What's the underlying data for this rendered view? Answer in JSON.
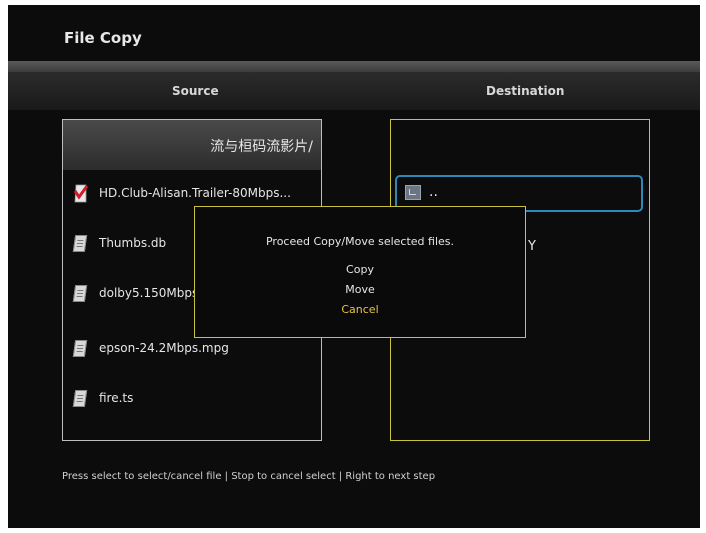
{
  "title": "File Copy",
  "columns": {
    "source": "Source",
    "destination": "Destination"
  },
  "source_panel": {
    "path": "流与桓码流影片/",
    "files": [
      {
        "name": "HD.Club-Alisan.Trailer-80Mbps...",
        "icon": "selected-check-icon",
        "selected": true
      },
      {
        "name": "Thumbs.db",
        "icon": "file-icon",
        "selected": false
      },
      {
        "name": "dolby5.150Mbps",
        "icon": "file-icon",
        "selected": false
      },
      {
        "name": "epson-24.2Mbps.mpg",
        "icon": "file-icon",
        "selected": false
      },
      {
        "name": "fire.ts",
        "icon": "file-icon",
        "selected": false
      }
    ]
  },
  "destination_panel": {
    "selected_item": "..",
    "selected_icon": "folder-up-icon",
    "partial_item": "Y"
  },
  "dialog": {
    "message": "Proceed Copy/Move selected files.",
    "options": [
      "Copy",
      "Move",
      "Cancel"
    ],
    "highlighted_option": "Cancel"
  },
  "footer": {
    "hint": "Press select to select/cancel file | Stop to cancel select | Right to next step"
  },
  "colors": {
    "background": "#0c0c0c",
    "panel_border_source": "#bdbdbd",
    "panel_border_destination": "#c9c23a",
    "selection_border": "#2e89b8",
    "highlight_text": "#e8c24a"
  }
}
